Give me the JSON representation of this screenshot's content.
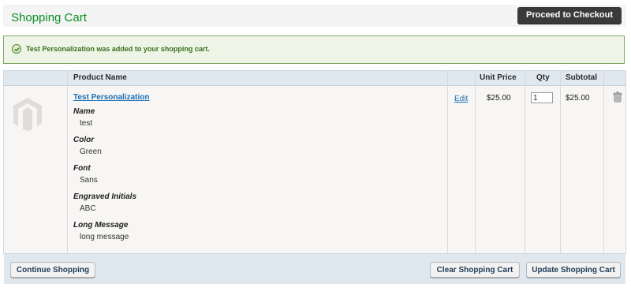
{
  "header": {
    "title": "Shopping Cart",
    "checkout_label": "Proceed to Checkout"
  },
  "message": {
    "text": "Test Personalization was added to your shopping cart."
  },
  "table": {
    "columns": [
      "Product Name",
      "Unit Price",
      "Qty",
      "Subtotal"
    ],
    "item": {
      "name": "Test Personalization",
      "edit_label": "Edit",
      "unit_price": "$25.00",
      "qty": "1",
      "subtotal": "$25.00",
      "options": [
        {
          "label": "Name",
          "value": "test"
        },
        {
          "label": "Color",
          "value": "Green"
        },
        {
          "label": "Font",
          "value": "Sans"
        },
        {
          "label": "Engraved Initials",
          "value": "ABC"
        },
        {
          "label": "Long Message",
          "value": "long message"
        }
      ]
    }
  },
  "footer": {
    "continue_label": "Continue Shopping",
    "clear_label": "Clear Shopping Cart",
    "update_label": "Update Shopping Cart"
  }
}
